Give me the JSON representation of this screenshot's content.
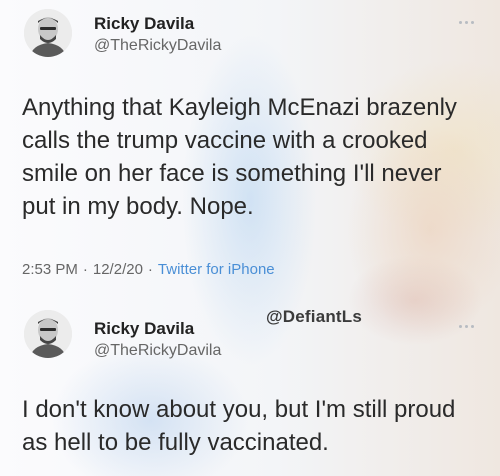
{
  "tweets": [
    {
      "author_name": "Ricky Davila",
      "author_handle": "@TheRickyDavila",
      "text": "Anything that Kayleigh McEnazi brazenly calls the trump vaccine with a crooked smile on her face is something I'll never put in my body. Nope.",
      "time": "2:53 PM",
      "date": "12/2/20",
      "source": "Twitter for iPhone"
    },
    {
      "author_name": "Ricky Davila",
      "author_handle": "@TheRickyDavila",
      "text": "I don't know about you, but I'm still proud as hell to be fully vaccinated."
    }
  ],
  "watermark": "@DefiantLs",
  "meta_separator": "·",
  "icons": {
    "avatar": "avatar-photo",
    "more": "more-dots-icon"
  },
  "colors": {
    "name": "#222222",
    "handle": "#666666",
    "source_link": "#4a8fd6"
  }
}
